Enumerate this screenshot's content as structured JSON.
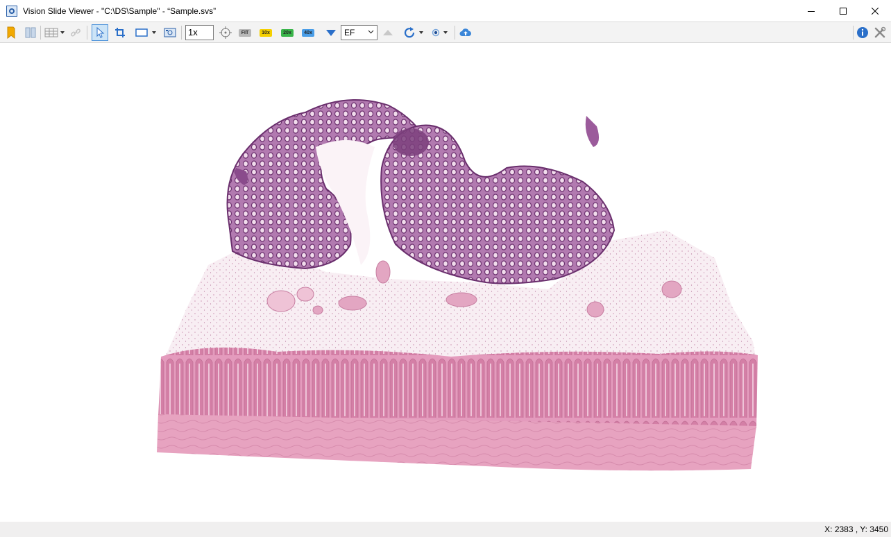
{
  "window": {
    "title": "Vision Slide Viewer - \"C:\\DS\\Sample\" - “Sample.svs”"
  },
  "toolbar": {
    "zoom_value": "1x",
    "fit_label": "FIT",
    "mag_10_label": "10x",
    "mag_20_label": "20x",
    "mag_40_label": "40x",
    "filter_value": "EF"
  },
  "status": {
    "coordinates": "X: 2383 , Y: 3450"
  },
  "colors": {
    "toolbar_bg": "#f3f3f3",
    "accent": "#2a6fc9",
    "mag_10": "#f5d000",
    "mag_20": "#39b54a",
    "mag_40": "#4a9ee8",
    "tissue_pink": "#dc8fb0",
    "tissue_purple": "#7b3f7d"
  },
  "icons": [
    "app-icon",
    "minimize-icon",
    "maximize-icon",
    "close-icon",
    "bookmark-icon",
    "compare-icon",
    "grid-icon",
    "link-icon",
    "select-pointer-icon",
    "crop-icon",
    "rectangle-icon",
    "snapshot-icon",
    "center-target-icon",
    "triangle-down-icon",
    "triangle-up-icon",
    "rotate-icon",
    "circle-dot-icon",
    "upload-cloud-icon",
    "info-icon",
    "tools-icon"
  ]
}
